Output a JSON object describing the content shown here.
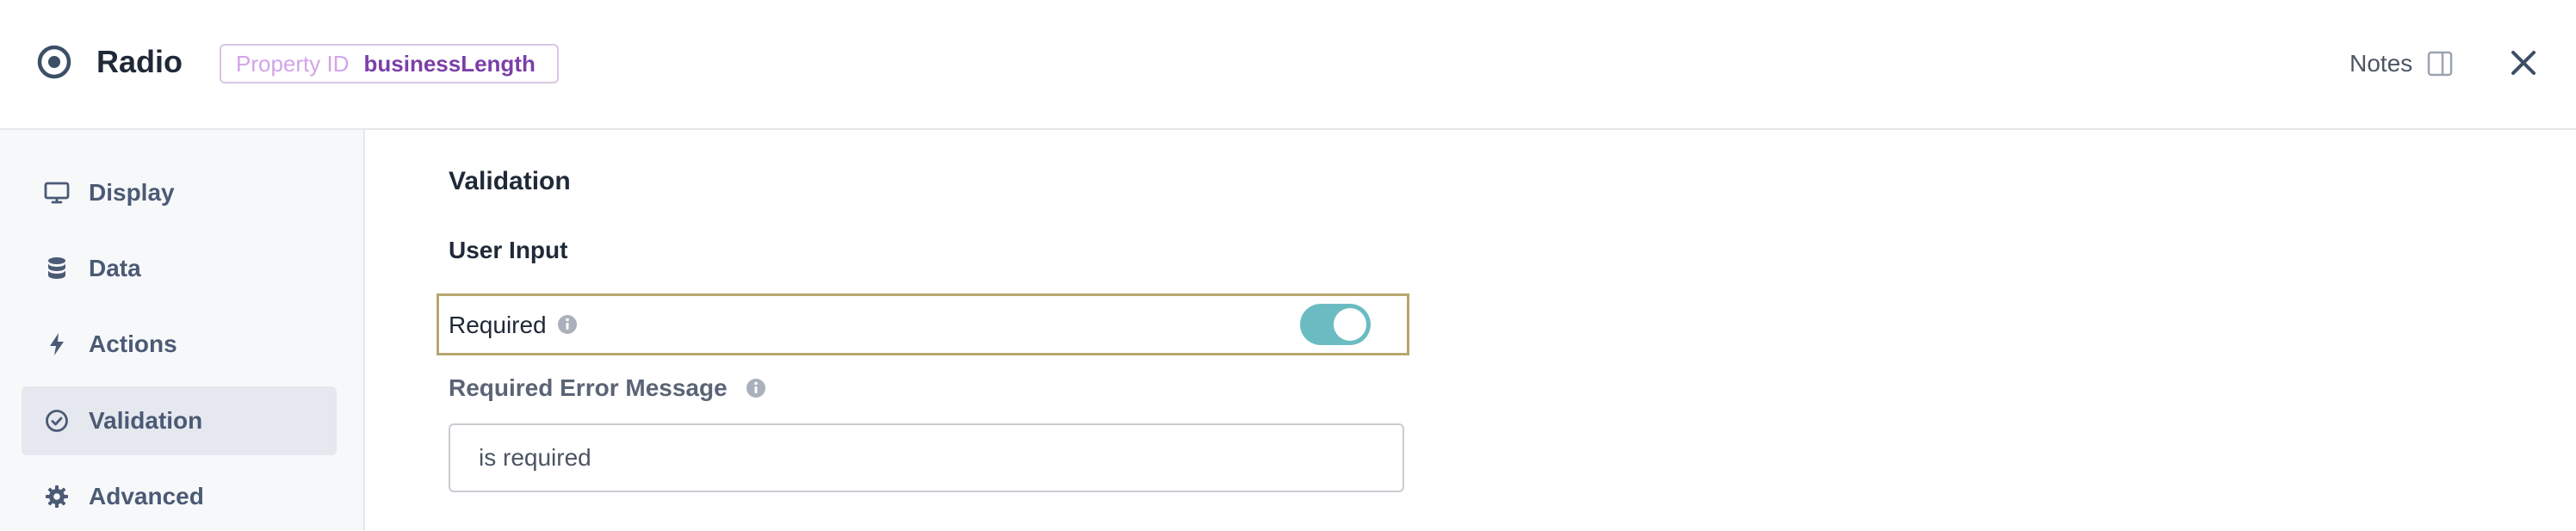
{
  "header": {
    "title": "Radio",
    "property_id_label": "Property ID",
    "property_id_value": "businessLength",
    "notes_label": "Notes"
  },
  "sidebar": {
    "items": [
      {
        "label": "Display",
        "icon": "monitor-icon"
      },
      {
        "label": "Data",
        "icon": "database-icon"
      },
      {
        "label": "Actions",
        "icon": "bolt-icon"
      },
      {
        "label": "Validation",
        "icon": "check-circle-icon",
        "active": true
      },
      {
        "label": "Advanced",
        "icon": "gear-icon"
      }
    ]
  },
  "main": {
    "section_title": "Validation",
    "sub_title": "User Input",
    "required_label": "Required",
    "required_enabled": true,
    "error_message_label": "Required Error Message",
    "error_message_value": "is required"
  },
  "colors": {
    "toggle_on": "#6bbcc2",
    "highlight_border": "#b5a76e",
    "property_value": "#7b3fa8",
    "sidebar_active": "#e5e8ee"
  }
}
